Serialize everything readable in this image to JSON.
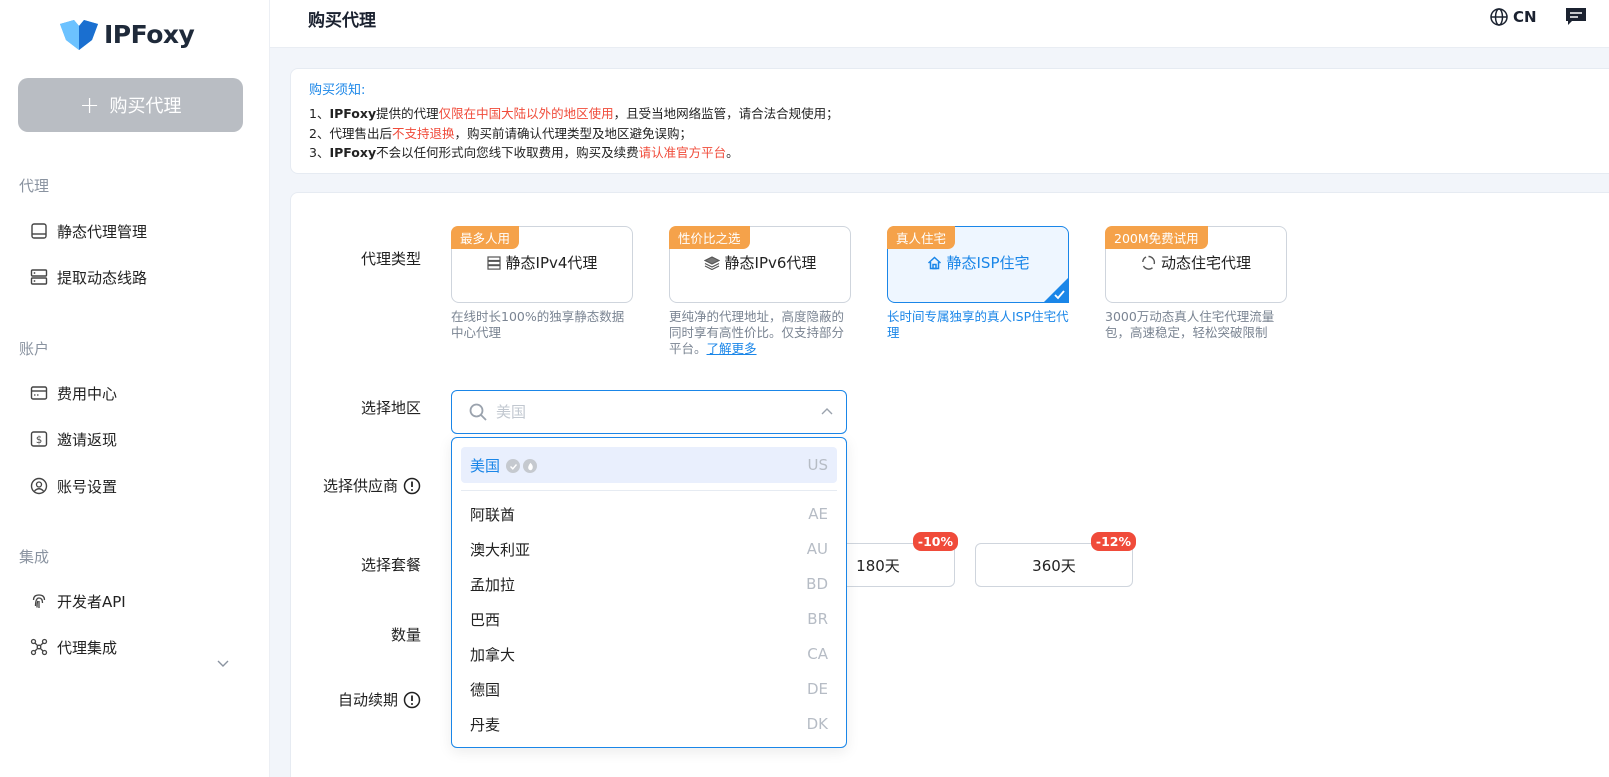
{
  "app": {
    "brand": "IPFoxy"
  },
  "sidebar": {
    "buy_button": "购买代理",
    "sections": [
      {
        "title": "代理",
        "items": [
          {
            "label": "静态代理管理",
            "icon": "monitor-icon"
          },
          {
            "label": "提取动态线路",
            "icon": "server-icon"
          }
        ]
      },
      {
        "title": "账户",
        "items": [
          {
            "label": "费用中心",
            "icon": "card-icon"
          },
          {
            "label": "邀请返现",
            "icon": "dollar-icon"
          },
          {
            "label": "账号设置",
            "icon": "user-circle-icon"
          }
        ]
      },
      {
        "title": "集成",
        "items": [
          {
            "label": "开发者API",
            "icon": "fingerprint-icon"
          },
          {
            "label": "代理集成",
            "icon": "nodes-icon"
          }
        ]
      }
    ]
  },
  "header": {
    "title": "购买代理",
    "lang": "CN"
  },
  "notice": {
    "title": "购买须知:",
    "line1": {
      "prefix": "1、",
      "brand": "IPFoxy",
      "a": "提供的代理",
      "red": "仅限在中国大陆以外的地区使用",
      "b": "，且受当地网络监管，请合法合规使用；"
    },
    "line2": {
      "a": "2、代理售出后",
      "red": "不支持退换",
      "b": "，购买前请确认代理类型及地区避免误购；"
    },
    "line3": {
      "prefix": "3、",
      "brand": "IPFoxy",
      "a": "不会以任何形式向您线下收取费用，购买及续费",
      "red": "请认准官方平台",
      "b": "。"
    }
  },
  "form": {
    "labels": {
      "type": "代理类型",
      "region": "选择地区",
      "provider": "选择供应商",
      "plan": "选择套餐",
      "quantity": "数量",
      "auto_renew": "自动续期"
    },
    "types": [
      {
        "badge": "最多人用",
        "name": "静态IPv4代理",
        "icon": "server-stack-icon",
        "desc": "在线时长100%的独享静态数据中心代理",
        "active": false
      },
      {
        "badge": "性价比之选",
        "name": "静态IPv6代理",
        "icon": "layers-icon",
        "desc": "更纯净的代理地址，高度隐蔽的同时享有高性价比。仅支持部分平台。",
        "link": "了解更多",
        "active": false
      },
      {
        "badge": "真人住宅",
        "name": "静态ISP住宅",
        "icon": "home-icon",
        "desc": "长时间专属独享的真人ISP住宅代理",
        "active": true
      },
      {
        "badge": "200M免费试用",
        "name": "动态住宅代理",
        "icon": "recycle-icon",
        "desc": "3000万动态真人住宅代理流量包，高速稳定，轻松突破限制",
        "active": false
      }
    ],
    "region": {
      "placeholder": "美国",
      "value": ""
    },
    "plans": [
      {
        "label": "180天",
        "discount": "-10%"
      },
      {
        "label": "360天",
        "discount": "-12%"
      }
    ]
  },
  "dropdown": {
    "items": [
      {
        "name": "美国",
        "code": "US",
        "selected": true
      },
      {
        "name": "阿联酋",
        "code": "AE"
      },
      {
        "name": "澳大利亚",
        "code": "AU"
      },
      {
        "name": "孟加拉",
        "code": "BD"
      },
      {
        "name": "巴西",
        "code": "BR"
      },
      {
        "name": "加拿大",
        "code": "CA"
      },
      {
        "name": "德国",
        "code": "DE"
      },
      {
        "name": "丹麦",
        "code": "DK"
      }
    ]
  },
  "colors": {
    "accent": "#1a86e8",
    "badge": "#f5a24a",
    "danger": "#f04b3a",
    "button_disabled": "#b9bdc3"
  }
}
